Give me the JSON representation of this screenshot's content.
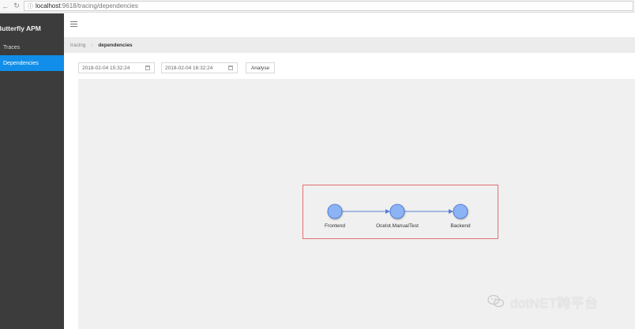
{
  "browser": {
    "url_host": "localhost",
    "url_path": ":9618/tracing/dependencies"
  },
  "sidebar": {
    "brand": "Butterfly APM",
    "items": [
      {
        "label": "Traces",
        "active": false
      },
      {
        "label": "Dependencies",
        "active": true
      }
    ]
  },
  "breadcrumb": {
    "root": "tracing",
    "separator": "/",
    "current": "dependencies"
  },
  "filters": {
    "start_time": "2018-02-04 15:32:24",
    "end_time": "2018-02-04 16:32:24",
    "analyse_label": "Analyse"
  },
  "graph": {
    "nodes": [
      {
        "id": "frontend",
        "label": "Frontend"
      },
      {
        "id": "ocelot",
        "label": "Ocelot.ManualTest"
      },
      {
        "id": "backend",
        "label": "Backend"
      }
    ],
    "edges": [
      {
        "from": "frontend",
        "to": "ocelot"
      },
      {
        "from": "ocelot",
        "to": "backend"
      }
    ],
    "node_fill": "#8cb4f5",
    "node_stroke": "#3d6fcf",
    "edge_color": "#5b7fd6",
    "highlight_border": "#e07070"
  },
  "watermark": {
    "text": "dotNET跨平台"
  }
}
